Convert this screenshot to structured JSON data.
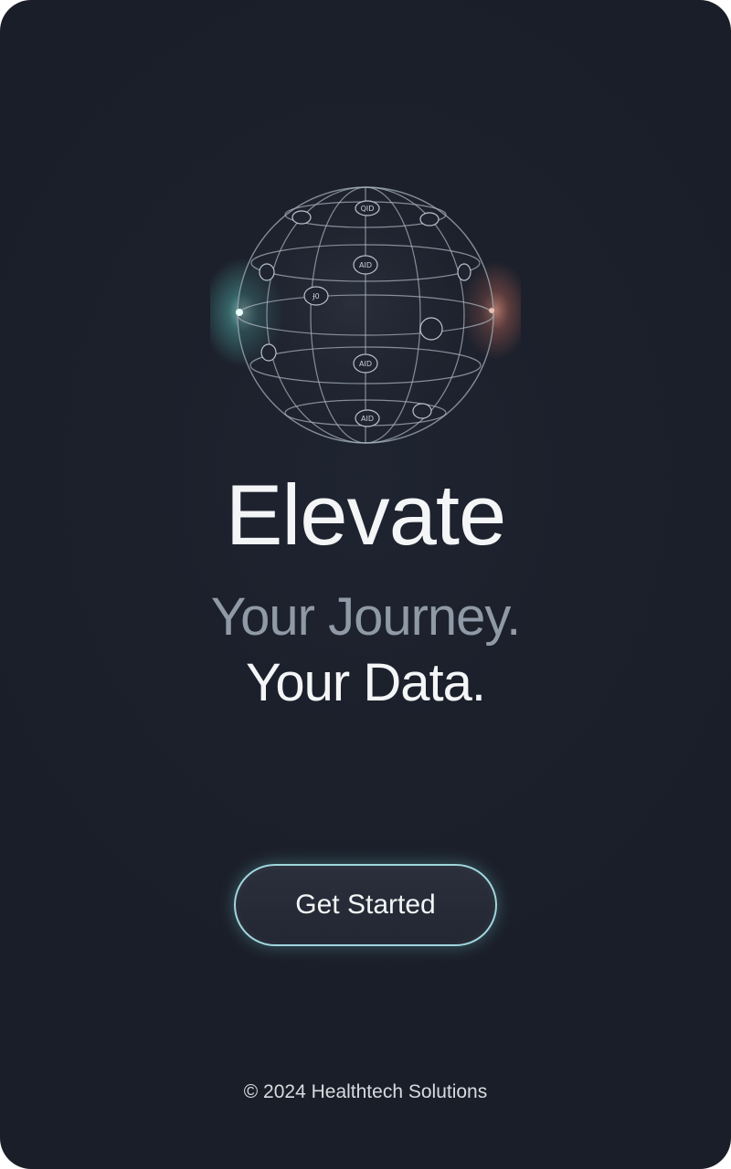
{
  "hero": {
    "headline": "Elevate",
    "subline_1": "Your Journey.",
    "subline_2": "Your Data."
  },
  "cta": {
    "label": "Get Started"
  },
  "footer": {
    "text": "© 2024 Healthtech Solutions"
  },
  "globe": {
    "icon": "globe-network-icon",
    "node_labels": [
      "QID",
      "AID",
      "Ɉ0",
      "AID",
      "AID"
    ]
  },
  "colors": {
    "background": "#1c202b",
    "headline": "#f4f5f7",
    "subline_muted": "#8f9aa6",
    "accent_teal": "#7fe3dc",
    "accent_coral": "#e8806a",
    "button_border": "#9fd6dc"
  }
}
